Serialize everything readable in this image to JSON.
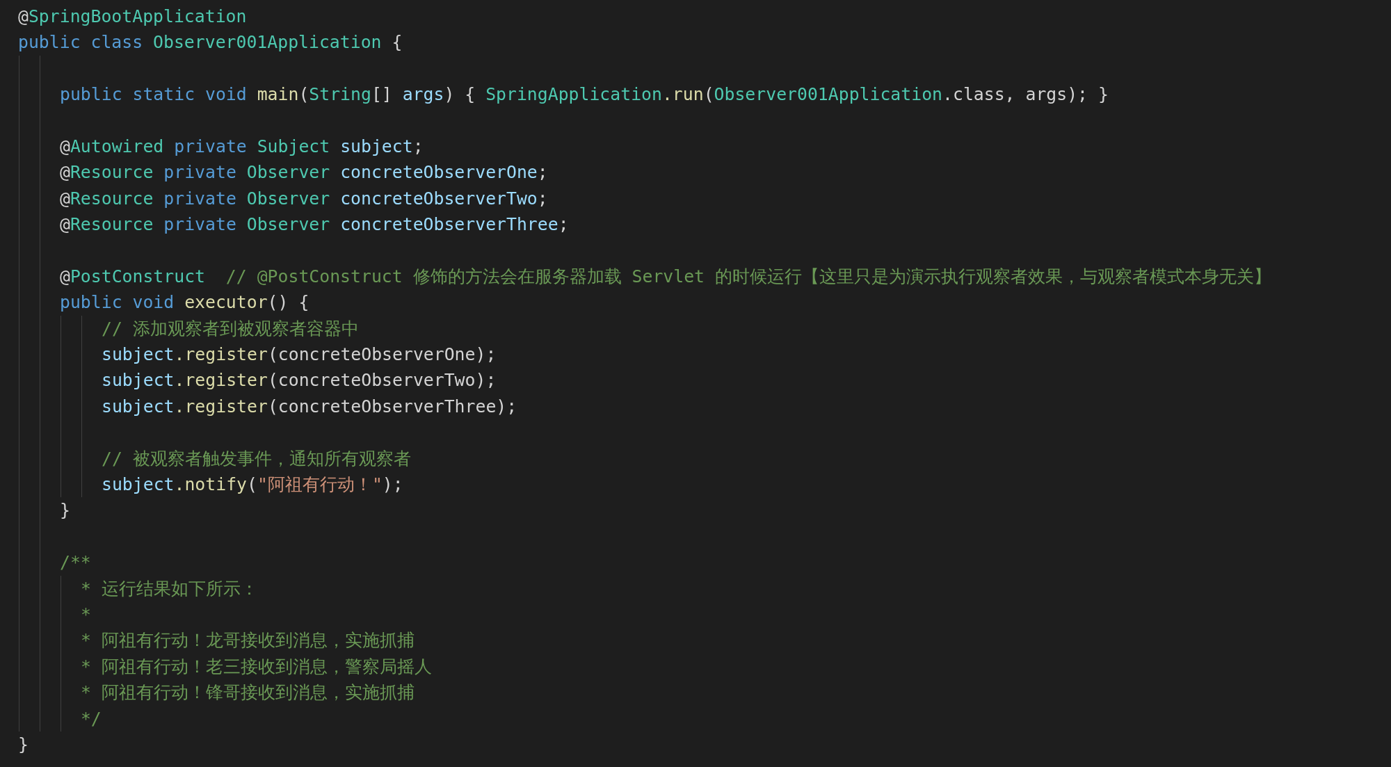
{
  "editor": {
    "lines": [
      {
        "kind": "code",
        "tokens": [
          {
            "kind": "plain",
            "text": "@"
          },
          {
            "kind": "type",
            "text": "SpringBootApplication"
          }
        ]
      },
      {
        "kind": "code",
        "tokens": [
          {
            "kind": "keyword",
            "text": "public class "
          },
          {
            "kind": "type",
            "text": "Observer001Application"
          },
          {
            "kind": "plain",
            "text": " {"
          }
        ],
        "children": [
          {
            "kind": "blank"
          },
          {
            "kind": "code",
            "tokens": [
              {
                "kind": "keyword",
                "text": "public static void "
              },
              {
                "kind": "function",
                "text": "main"
              },
              {
                "kind": "plain",
                "text": "("
              },
              {
                "kind": "type",
                "text": "String"
              },
              {
                "kind": "plain",
                "text": "[] "
              },
              {
                "kind": "variable",
                "text": "args"
              },
              {
                "kind": "plain",
                "text": ") { "
              },
              {
                "kind": "type",
                "text": "SpringApplication"
              },
              {
                "kind": "function",
                "text": ".run"
              },
              {
                "kind": "plain",
                "text": "("
              },
              {
                "kind": "type",
                "text": "Observer001Application"
              },
              {
                "kind": "plain",
                "text": ".class, args); }"
              }
            ]
          },
          {
            "kind": "blank"
          },
          {
            "kind": "code",
            "tokens": [
              {
                "kind": "plain",
                "text": "@"
              },
              {
                "kind": "type",
                "text": "Autowired"
              },
              {
                "kind": "keyword",
                "text": " private "
              },
              {
                "kind": "type",
                "text": "Subject "
              },
              {
                "kind": "variable",
                "text": "subject"
              },
              {
                "kind": "plain",
                "text": ";"
              }
            ]
          },
          {
            "kind": "code",
            "tokens": [
              {
                "kind": "plain",
                "text": "@"
              },
              {
                "kind": "type",
                "text": "Resource"
              },
              {
                "kind": "keyword",
                "text": " private "
              },
              {
                "kind": "type",
                "text": "Observer "
              },
              {
                "kind": "variable",
                "text": "concreteObserverOne"
              },
              {
                "kind": "plain",
                "text": ";"
              }
            ]
          },
          {
            "kind": "code",
            "tokens": [
              {
                "kind": "plain",
                "text": "@"
              },
              {
                "kind": "type",
                "text": "Resource"
              },
              {
                "kind": "keyword",
                "text": " private "
              },
              {
                "kind": "type",
                "text": "Observer "
              },
              {
                "kind": "variable",
                "text": "concreteObserverTwo"
              },
              {
                "kind": "plain",
                "text": ";"
              }
            ]
          },
          {
            "kind": "code",
            "tokens": [
              {
                "kind": "plain",
                "text": "@"
              },
              {
                "kind": "type",
                "text": "Resource"
              },
              {
                "kind": "keyword",
                "text": " private "
              },
              {
                "kind": "type",
                "text": "Observer "
              },
              {
                "kind": "variable",
                "text": "concreteObserverThree"
              },
              {
                "kind": "plain",
                "text": ";"
              }
            ]
          },
          {
            "kind": "blank"
          },
          {
            "kind": "code",
            "tokens": [
              {
                "kind": "plain",
                "text": "@"
              },
              {
                "kind": "type",
                "text": "PostConstruct"
              },
              {
                "kind": "comment",
                "text": "  // @PostConstruct 修饰的方法会在服务器加载 Servlet 的时候运行【这里只是为演示执行观察者效果，与观察者模式本身无关】"
              }
            ]
          },
          {
            "kind": "code",
            "tokens": [
              {
                "kind": "keyword",
                "text": "public void "
              },
              {
                "kind": "function",
                "text": "executor"
              },
              {
                "kind": "plain",
                "text": "() {"
              }
            ],
            "children": [
              {
                "kind": "code",
                "tokens": [
                  {
                    "kind": "comment",
                    "text": "// 添加观察者到被观察者容器中"
                  }
                ]
              },
              {
                "kind": "code",
                "tokens": [
                  {
                    "kind": "variable",
                    "text": "subject"
                  },
                  {
                    "kind": "function",
                    "text": ".register"
                  },
                  {
                    "kind": "plain",
                    "text": "(concreteObserverOne);"
                  }
                ]
              },
              {
                "kind": "code",
                "tokens": [
                  {
                    "kind": "variable",
                    "text": "subject"
                  },
                  {
                    "kind": "function",
                    "text": ".register"
                  },
                  {
                    "kind": "plain",
                    "text": "(concreteObserverTwo);"
                  }
                ]
              },
              {
                "kind": "code",
                "tokens": [
                  {
                    "kind": "variable",
                    "text": "subject"
                  },
                  {
                    "kind": "function",
                    "text": ".register"
                  },
                  {
                    "kind": "plain",
                    "text": "(concreteObserverThree);"
                  }
                ]
              },
              {
                "kind": "blank"
              },
              {
                "kind": "code",
                "tokens": [
                  {
                    "kind": "comment",
                    "text": "// 被观察者触发事件，通知所有观察者"
                  }
                ]
              },
              {
                "kind": "code",
                "tokens": [
                  {
                    "kind": "variable",
                    "text": "subject"
                  },
                  {
                    "kind": "function",
                    "text": ".notify"
                  },
                  {
                    "kind": "plain",
                    "text": "("
                  },
                  {
                    "kind": "string",
                    "text": "\"阿祖有行动！\""
                  },
                  {
                    "kind": "plain",
                    "text": ");"
                  }
                ]
              }
            ]
          },
          {
            "kind": "code",
            "tokens": [
              {
                "kind": "plain",
                "text": "}"
              }
            ]
          },
          {
            "kind": "blank"
          },
          {
            "kind": "code",
            "tokens": [
              {
                "kind": "comment",
                "text": "/**"
              }
            ],
            "children": [
              {
                "kind": "code",
                "tokens": [
                  {
                    "kind": "comment",
                    "text": " * 运行结果如下所示："
                  }
                ]
              },
              {
                "kind": "code",
                "tokens": [
                  {
                    "kind": "comment",
                    "text": " *"
                  }
                ]
              },
              {
                "kind": "code",
                "tokens": [
                  {
                    "kind": "comment",
                    "text": " * 阿祖有行动！龙哥接收到消息，实施抓捕"
                  }
                ]
              },
              {
                "kind": "code",
                "tokens": [
                  {
                    "kind": "comment",
                    "text": " * 阿祖有行动！老三接收到消息，警察局摇人"
                  }
                ]
              },
              {
                "kind": "code",
                "tokens": [
                  {
                    "kind": "comment",
                    "text": " * 阿祖有行动！锋哥接收到消息，实施抓捕"
                  }
                ]
              },
              {
                "kind": "code",
                "tokens": [
                  {
                    "kind": "comment",
                    "text": " */"
                  }
                ]
              }
            ]
          }
        ]
      },
      {
        "kind": "code",
        "tokens": [
          {
            "kind": "plain",
            "text": "}"
          }
        ]
      }
    ]
  }
}
